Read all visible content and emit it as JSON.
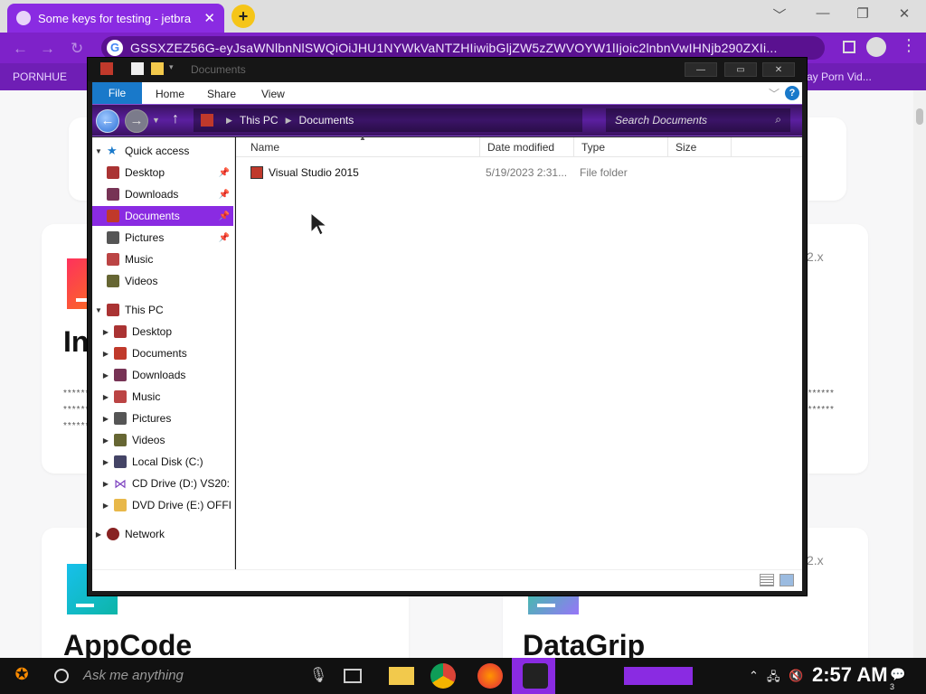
{
  "browser": {
    "tab_title": "Some keys for testing - jetbra",
    "tab_close": "✕",
    "new_tab": "+",
    "url": "GSSXZEZ56G-eyJsaWNlbnNlSWQiOiJHU1NYWkVaNTZHIiwibGljZW5zZWVOYW1lIjoic2lnbnVwIHNjb290ZXIi...",
    "bookmarks": [
      "PORNHUE",
      "ay Porn Vid..."
    ],
    "window_controls": [
      "﹀",
      "—",
      "❐",
      "✕"
    ],
    "menu": "⋮"
  },
  "page": {
    "cards": [
      {
        "name": "In",
        "version": "2.x"
      },
      {
        "name": "AppCode",
        "version": "2.x"
      },
      {
        "name": "DataGrip",
        "version": ""
      }
    ],
    "stars": "*******************"
  },
  "explorer": {
    "title": "Documents",
    "controls": [
      "—",
      "▭",
      "✕"
    ],
    "ribbon_tabs": [
      "File",
      "Home",
      "Share",
      "View"
    ],
    "help": "?",
    "breadcrumb": [
      "This PC",
      "Documents"
    ],
    "search_placeholder": "Search Documents",
    "columns": [
      "Name",
      "Date modified",
      "Type",
      "Size"
    ],
    "files": [
      {
        "name": "Visual Studio 2015",
        "date": "5/19/2023 2:31...",
        "type": "File folder",
        "size": ""
      }
    ],
    "nav": {
      "quick_access": "Quick access",
      "quick_items": [
        "Desktop",
        "Downloads",
        "Documents",
        "Pictures",
        "Music",
        "Videos"
      ],
      "this_pc": "This PC",
      "pc_items": [
        "Desktop",
        "Documents",
        "Downloads",
        "Music",
        "Pictures",
        "Videos",
        "Local Disk (C:)",
        "CD Drive (D:) VS20:",
        "DVD Drive (E:) OFFI"
      ],
      "network": "Network"
    }
  },
  "taskbar": {
    "search_placeholder": "Ask me anything",
    "clock": "2:57 AM",
    "notif_count": "3"
  },
  "colors": {
    "accent": "#8a2be2",
    "ribbon_blue": "#1979ca"
  }
}
